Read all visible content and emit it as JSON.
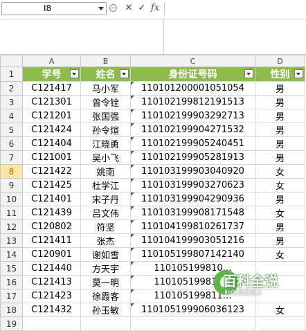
{
  "formula_bar": {
    "name_box": "I8",
    "fx_label": "fx"
  },
  "columns": [
    "A",
    "B",
    "C",
    "D"
  ],
  "header": [
    "学号",
    "姓名",
    "身份证号码",
    "性别"
  ],
  "active_row": 8,
  "rows": [
    {
      "num": "2",
      "id": "C121417",
      "name": "马小军",
      "idcard": "110101200001051054",
      "sex": "男"
    },
    {
      "num": "3",
      "id": "C121301",
      "name": "曾令铨",
      "idcard": "110102199812191513",
      "sex": "男"
    },
    {
      "num": "4",
      "id": "C121201",
      "name": "张国强",
      "idcard": "110102199903292713",
      "sex": "男"
    },
    {
      "num": "5",
      "id": "C121424",
      "name": "孙令煊",
      "idcard": "110102199904271532",
      "sex": "男"
    },
    {
      "num": "6",
      "id": "C121404",
      "name": "江晓勇",
      "idcard": "110102199905240451",
      "sex": "男"
    },
    {
      "num": "7",
      "id": "C121001",
      "name": "吴小飞",
      "idcard": "110102199905281913",
      "sex": "男"
    },
    {
      "num": "8",
      "id": "C121422",
      "name": "姚南",
      "idcard": "110103199903040920",
      "sex": "女"
    },
    {
      "num": "9",
      "id": "C121425",
      "name": "杜学江",
      "idcard": "110103199903270623",
      "sex": "女"
    },
    {
      "num": "10",
      "id": "C121401",
      "name": "宋子丹",
      "idcard": "110103199904290936",
      "sex": "男"
    },
    {
      "num": "11",
      "id": "C121439",
      "name": "吕文伟",
      "idcard": "110103199908171548",
      "sex": "女"
    },
    {
      "num": "12",
      "id": "C120802",
      "name": "符坚",
      "idcard": "110104199810261737",
      "sex": "男"
    },
    {
      "num": "13",
      "id": "C121411",
      "name": "张杰",
      "idcard": "110104199903051216",
      "sex": "男"
    },
    {
      "num": "14",
      "id": "C120901",
      "name": "谢如雪",
      "idcard": "110105199807142140",
      "sex": "女"
    },
    {
      "num": "15",
      "id": "C121440",
      "name": "方天宇",
      "idcard": "110105199810…",
      "sex": ""
    },
    {
      "num": "16",
      "id": "C121413",
      "name": "莫一明",
      "idcard": "110105199810…",
      "sex": ""
    },
    {
      "num": "17",
      "id": "C121423",
      "name": "徐霞客",
      "idcard": "110105199811…",
      "sex": ""
    },
    {
      "num": "18",
      "id": "C121432",
      "name": "孙玉敏",
      "idcard": "110105199906036123",
      "sex": "女"
    },
    {
      "num": "19",
      "id": "",
      "name": "",
      "idcard": "",
      "sex": ""
    }
  ],
  "watermark": {
    "title": "百科全说",
    "subtitle": "助你轻松解决"
  }
}
